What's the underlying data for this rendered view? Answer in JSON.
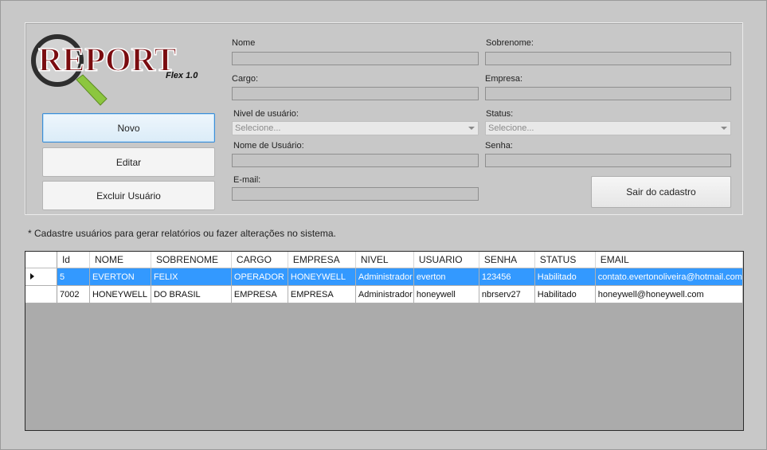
{
  "logo": {
    "title": "REPORT",
    "subtitle": "Flex 1.0"
  },
  "buttons": {
    "novo": "Novo",
    "editar": "Editar",
    "excluir": "Excluir Usuário",
    "sair": "Sair do cadastro"
  },
  "form": {
    "nome_label": "Nome",
    "nome_value": "",
    "sobrenome_label": "Sobrenome:",
    "sobrenome_value": "",
    "cargo_label": "Cargo:",
    "cargo_value": "",
    "empresa_label": "Empresa:",
    "empresa_value": "",
    "nivel_label": "Nivel de usuário:",
    "nivel_value": "Selecione...",
    "status_label": "Status:",
    "status_value": "Selecione...",
    "usuario_label": "Nome de Usuário:",
    "usuario_value": "",
    "senha_label": "Senha:",
    "senha_value": "",
    "email_label": "E-mail:",
    "email_value": ""
  },
  "note": "* Cadastre usuários para gerar relatórios ou fazer alterações no sistema.",
  "grid": {
    "columns": [
      "Id",
      "NOME",
      "SOBRENOME",
      "CARGO",
      "EMPRESA",
      "NIVEL",
      "USUARIO",
      "SENHA",
      "STATUS",
      "EMAIL"
    ],
    "rows": [
      [
        "5",
        "EVERTON",
        "FELIX",
        "OPERADOR",
        "HONEYWELL",
        "Administrador",
        "everton",
        "123456",
        "Habilitado",
        "contato.evertonoliveira@hotmail.com"
      ],
      [
        "7002",
        "HONEYWELL",
        "DO BRASIL",
        "EMPRESA",
        "EMPRESA",
        "Administrador",
        "honeywell",
        "nbrserv27",
        "Habilitado",
        "honeywell@honeywell.com"
      ]
    ],
    "selected_row": 0
  },
  "colors": {
    "selection": "#3399ff",
    "logo_red": "#7a0c10",
    "handle_green": "#8cc63f"
  }
}
